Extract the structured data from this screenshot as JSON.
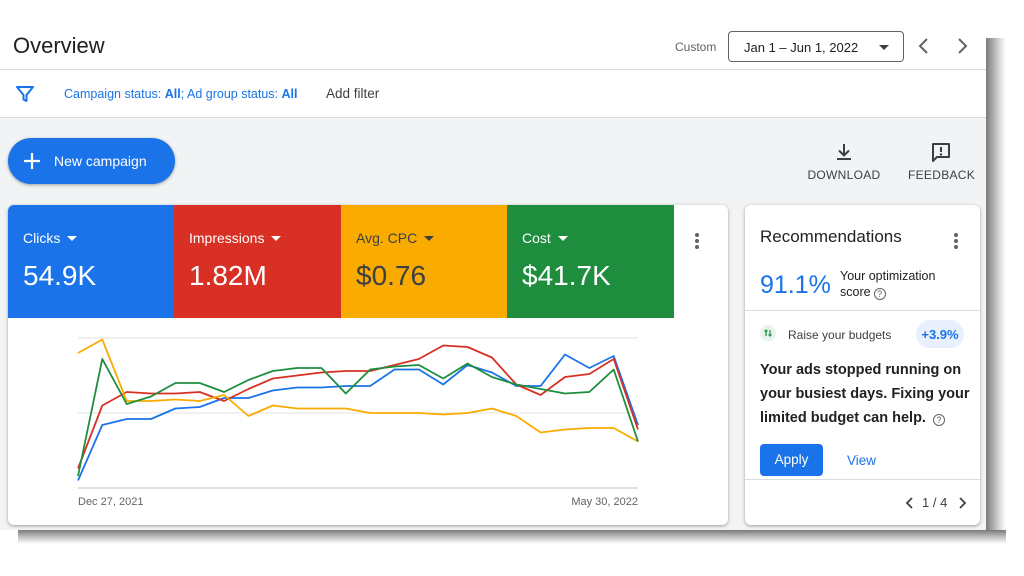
{
  "header": {
    "title": "Overview",
    "custom_label": "Custom",
    "date_range": "Jan 1 – Jun 1, 2022",
    "prev_icon": "chevron-left-icon",
    "next_icon": "chevron-right-icon"
  },
  "filters": {
    "icon": "filter-icon",
    "campaign_status_label": "Campaign status: ",
    "campaign_status_value": "All",
    "separator": "; ",
    "ad_group_status_label": "Ad group status: ",
    "ad_group_status_value": "All",
    "add_filter_label": "Add filter"
  },
  "actions": {
    "new_campaign_label": "New campaign",
    "download_label": "DOWNLOAD",
    "feedback_label": "FEEDBACK"
  },
  "metrics": [
    {
      "name": "Clicks",
      "value": "54.9K",
      "color": "#1a73e8"
    },
    {
      "name": "Impressions",
      "value": "1.82M",
      "color": "#d93025"
    },
    {
      "name": "Avg. CPC",
      "value": "$0.76",
      "color": "#f9ab00"
    },
    {
      "name": "Cost",
      "value": "$41.7K",
      "color": "#1e8e3e"
    }
  ],
  "chart_data": {
    "type": "line",
    "x_start_label": "Dec 27, 2021",
    "x_end_label": "May 30, 2022",
    "grid": true,
    "series": [
      {
        "name": "Clicks",
        "color": "#1a73e8",
        "values": [
          5,
          42,
          46,
          46,
          53,
          54,
          60,
          60,
          65,
          67,
          67,
          68,
          68,
          79,
          79,
          69,
          82,
          77,
          68,
          68,
          89,
          80,
          88,
          42
        ]
      },
      {
        "name": "Impressions",
        "color": "#d93025",
        "values": [
          13,
          55,
          64,
          63,
          63,
          64,
          58,
          66,
          73,
          75,
          77,
          78,
          78,
          82,
          86,
          95,
          94,
          87,
          69,
          62,
          74,
          76,
          86,
          39
        ]
      },
      {
        "name": "Avg. CPC",
        "color": "#f9ab00",
        "values": [
          90,
          99,
          58,
          58,
          59,
          58,
          62,
          48,
          55,
          53,
          53,
          53,
          50,
          50,
          50,
          49,
          50,
          53,
          48,
          37,
          39,
          40,
          40,
          31
        ]
      },
      {
        "name": "Cost",
        "color": "#1e8e3e",
        "values": [
          8,
          86,
          56,
          61,
          70,
          70,
          64,
          72,
          78,
          80,
          80,
          63,
          79,
          81,
          82,
          73,
          83,
          74,
          69,
          66,
          63,
          64,
          79,
          31
        ]
      }
    ]
  },
  "recommendations": {
    "title": "Recommendations",
    "score": "91.1%",
    "score_label": "Your optimization score",
    "rec_type": "Raise your budgets",
    "uplift": "+3.9%",
    "body": "Your ads stopped running on your busiest days. Fixing your limited budget can help.",
    "help_glyph": "?",
    "apply_label": "Apply",
    "view_label": "View",
    "pager_text": "1 / 4"
  }
}
